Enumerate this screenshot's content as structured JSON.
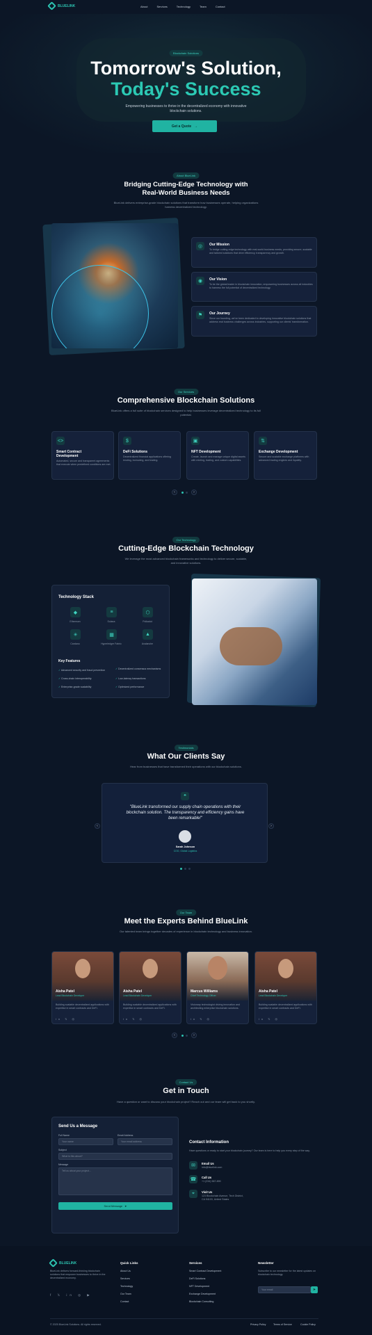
{
  "brand": {
    "name": "BLUELINK"
  },
  "nav": {
    "items": [
      "About",
      "Services",
      "Technology",
      "Team",
      "Contact"
    ]
  },
  "hero": {
    "badge": "Blockchain Solutions",
    "title1": "Tomorrow's Solution,",
    "title2": "Today's Success",
    "text1": "Empowering businesses to thrive in the decentralized economy with innovative",
    "text2": "blockchain solutions.",
    "cta": "Get a Quote",
    "cta_arrow": "→"
  },
  "about": {
    "badge": "About BlueLink",
    "title1": "Bridging Cutting-Edge Technology with",
    "title2": "Real-World Business Needs",
    "text": "BlueLink delivers enterprise-grade blockchain solutions that transform how businesses operate, helping organizations harness decentralized technology.",
    "cards": [
      {
        "title": "Our Mission",
        "text": "To bridge cutting-edge technology with real-world business needs, providing secure, scalable and tailored solutions that drive efficiency, transparency and growth."
      },
      {
        "title": "Our Vision",
        "text": "To be the global leader in blockchain innovation, empowering businesses across all industries to harness the full potential of decentralized technology."
      },
      {
        "title": "Our Journey",
        "text": "Since our founding, we've been dedicated to developing innovative blockchain solutions that address real business challenges across industries, supporting our clients' transformation."
      }
    ]
  },
  "services": {
    "badge": "Our Services",
    "title": "Comprehensive Blockchain Solutions",
    "text": "BlueLink offers a full suite of blockchain services designed to help businesses leverage decentralized technology to its full potential.",
    "cards": [
      {
        "title1": "Smart Contract",
        "title2": "Development",
        "text": "Automated, secure and transparent agreements that execute when predefined conditions are met."
      },
      {
        "title1": "DeFi Solutions",
        "title2": "",
        "text": "Decentralized financial applications offering lending, borrowing, and trading."
      },
      {
        "title1": "NFT Development",
        "title2": "",
        "text": "Create, launch and manage unique digital assets with minting, trading, and custom capabilities."
      },
      {
        "title1": "Exchange Development",
        "title2": "",
        "text": "Secure and scalable exchange platforms with advanced trading engines and liquidity."
      }
    ],
    "prev": "‹",
    "next": "›"
  },
  "tech": {
    "badge": "Our Technology",
    "title": "Cutting-Edge Blockchain Technology",
    "text1": "We leverage the most advanced blockchain frameworks and technology to deliver secure, scalable,",
    "text2": "and innovative solutions.",
    "stack_title": "Technology Stack",
    "stack": [
      "Ethereum",
      "Solana",
      "Polkadot",
      "Cardano",
      "Hyperledger Fabric",
      "Avalanche"
    ],
    "features_title": "Key Features",
    "features": [
      "Advanced security and fraud prevention",
      "Decentralized consensus mechanisms",
      "Cross-chain interoperability",
      "Low-latency transactions",
      "Enterprise-grade scalability",
      "Optimized performance"
    ]
  },
  "testimonials": {
    "badge": "Testimonials",
    "title": "What Our Clients Say",
    "text": "Hear from businesses that have transformed their operations with our blockchain solutions.",
    "quote1": "\"BlueLink transformed our supply chain operations with their",
    "quote2": "blockchain solution. The transparency and efficiency gains have",
    "quote3": "been remarkable!\"",
    "author": "Sarah Johnson",
    "role": "COO, Global Logistics",
    "prev": "‹",
    "next": "›"
  },
  "team": {
    "badge": "Our Team",
    "title": "Meet the Experts Behind BlueLink",
    "text": "Our talented team brings together decades of experience in blockchain technology and business innovation.",
    "members": [
      {
        "name": "Aisha Patel",
        "role": "Lead Blockchain Developer",
        "bio": "Building scalable decentralized applications with expertise in smart contracts and DeFi."
      },
      {
        "name": "Aisha Patel",
        "role": "Lead Blockchain Developer",
        "bio": "Building scalable decentralized applications with expertise in smart contracts and DeFi."
      },
      {
        "name": "Marcus Williams",
        "role": "Chief Technology Officer",
        "bio": "Visionary technologist driving innovation and architecting enterprise blockchain solutions."
      },
      {
        "name": "Aisha Patel",
        "role": "Lead Blockchain Developer",
        "bio": "Building scalable decentralized applications with expertise in smart contracts and DeFi."
      }
    ],
    "prev": "‹",
    "next": "›"
  },
  "contact": {
    "badge": "Contact Us",
    "title": "Get in Touch",
    "text": "Have a question or want to discuss your blockchain project? Reach out and our team will get back to you shortly.",
    "form_title": "Send Us a Message",
    "full_name": "Full Name",
    "name_ph": "Your name",
    "email": "Email Address",
    "email_ph": "Your email address",
    "subject": "Subject",
    "subject_ph": "What is this about?",
    "message": "Message",
    "message_ph": "Tell us about your project...",
    "send": "Send Message",
    "info_title": "Contact Information",
    "info_text": "Have questions or ready to start your blockchain journey? Our team is here to help you every step of the way.",
    "info": [
      {
        "label": "Email Us",
        "value": "info@bluelink.com"
      },
      {
        "label": "Call Us",
        "value": "+1 (234) 567-890"
      },
      {
        "label": "Visit Us",
        "value": "123 Blockchain Avenue, Tech District, CA 94103, United States"
      }
    ]
  },
  "footer": {
    "about": "BlueLink delivers forward-thinking blockchain solutions that empower businesses to thrive in the decentralized economy.",
    "cols": [
      {
        "title": "Quick Links",
        "links": [
          "About Us",
          "Services",
          "Technology",
          "Our Team",
          "Contact"
        ]
      },
      {
        "title": "Services",
        "links": [
          "Smart Contract Development",
          "DeFi Solutions",
          "NFT Development",
          "Exchange Development",
          "Blockchain Consulting"
        ]
      }
    ],
    "newsletter_title": "Newsletter",
    "newsletter_text": "Subscribe to our newsletter for the latest updates on blockchain technology.",
    "email_ph": "Your email",
    "copyright": "© 2025 BlueLink Solutions. All rights reserved.",
    "legal": [
      "Privacy Policy",
      "Terms of Service",
      "Cookie Policy"
    ]
  }
}
